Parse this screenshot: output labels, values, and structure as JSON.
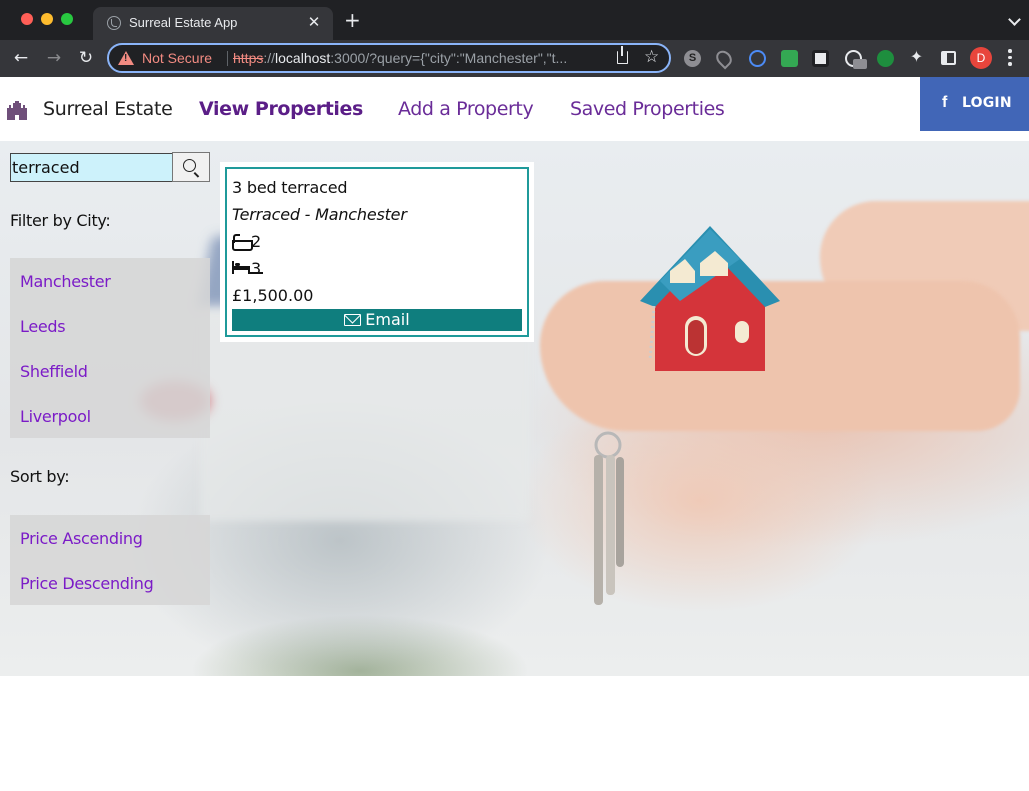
{
  "browser": {
    "tab_title": "Surreal Estate App",
    "tab_close": "✕",
    "new_tab": "+",
    "security_label": "Not Secure",
    "url_scheme": "https",
    "url_separator": "://",
    "url_host": "localhost",
    "url_rest": ":3000/?query={\"city\":\"Manchester\",\"t...",
    "profile_initial": "D",
    "extension_s": "S",
    "colors": {
      "accent": "#8ab4f8",
      "warning": "#f28b82",
      "profile": "#e8453c"
    }
  },
  "site": {
    "brand": "Surreal Estate",
    "nav": {
      "view_properties": "View Properties",
      "add_property": "Add a Property",
      "saved_properties": "Saved Properties"
    },
    "login": {
      "icon_glyph": "f",
      "label": "LOGIN"
    },
    "colors": {
      "nav": "#5a1f8a",
      "login": "#4166b7",
      "link": "#7b1bc7",
      "teal": "#0f7e7e"
    }
  },
  "sidebar": {
    "search_value": "terraced",
    "filter_heading": "Filter by City:",
    "cities": [
      "Manchester",
      "Leeds",
      "Sheffield",
      "Liverpool"
    ],
    "sort_heading": "Sort by:",
    "sort_options": [
      "Price Ascending",
      "Price Descending"
    ]
  },
  "properties": [
    {
      "title": "3 bed terraced",
      "type_city": "Terraced - Manchester",
      "bathrooms": "2",
      "bedrooms": "3",
      "price": "£1,500.00",
      "email_label": "Email"
    }
  ]
}
